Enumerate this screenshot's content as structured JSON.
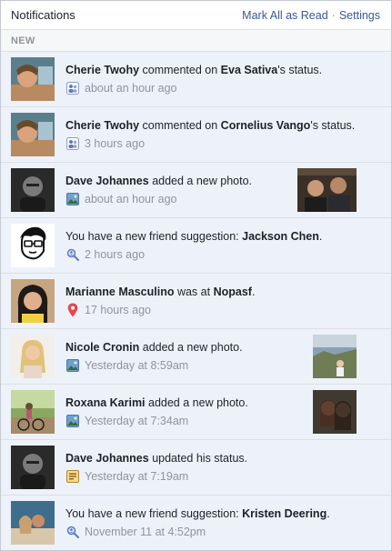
{
  "header": {
    "title": "Notifications",
    "mark_all_read": "Mark All as Read",
    "separator": "·",
    "settings": "Settings"
  },
  "section_label": "NEW",
  "notifications": [
    {
      "actor": "Cherie Twohy",
      "mid": " commented on ",
      "target": "Eva Sativa",
      "suffix": "'s status.",
      "time": "about an hour ago",
      "icon": "friends-comment-icon"
    },
    {
      "actor": "Cherie Twohy",
      "mid": " commented on ",
      "target": "Cornelius Vango",
      "suffix": "'s status.",
      "time": "3 hours ago",
      "icon": "friends-comment-icon"
    },
    {
      "actor": "Dave Johannes",
      "mid": " added a new photo.",
      "target": "",
      "suffix": "",
      "time": "about an hour ago",
      "icon": "photo-icon"
    },
    {
      "actor": "",
      "mid": "You have a new friend suggestion: ",
      "target": "Jackson Chen",
      "suffix": ".",
      "time": "2 hours ago",
      "icon": "friend-suggestion-icon"
    },
    {
      "actor": "Marianne Masculino",
      "mid": " was at ",
      "target": "Nopasf",
      "suffix": ".",
      "time": "17 hours ago",
      "icon": "location-pin-icon"
    },
    {
      "actor": "Nicole Cronin",
      "mid": " added a new photo.",
      "target": "",
      "suffix": "",
      "time": "Yesterday at 8:59am",
      "icon": "photo-icon"
    },
    {
      "actor": "Roxana Karimi",
      "mid": " added a new photo.",
      "target": "",
      "suffix": "",
      "time": "Yesterday at 7:34am",
      "icon": "photo-icon"
    },
    {
      "actor": "Dave Johannes",
      "mid": " updated his status.",
      "target": "",
      "suffix": "",
      "time": "Yesterday at 7:19am",
      "icon": "status-icon"
    },
    {
      "actor": "",
      "mid": "You have a new friend suggestion: ",
      "target": "Kristen Deering",
      "suffix": ".",
      "time": "November 11 at 4:52pm",
      "icon": "friend-suggestion-icon"
    }
  ],
  "colors": {
    "link": "#365899",
    "unread_bg": "#edf2fa",
    "meta_text": "#90949c",
    "pin_red": "#e5484d"
  }
}
